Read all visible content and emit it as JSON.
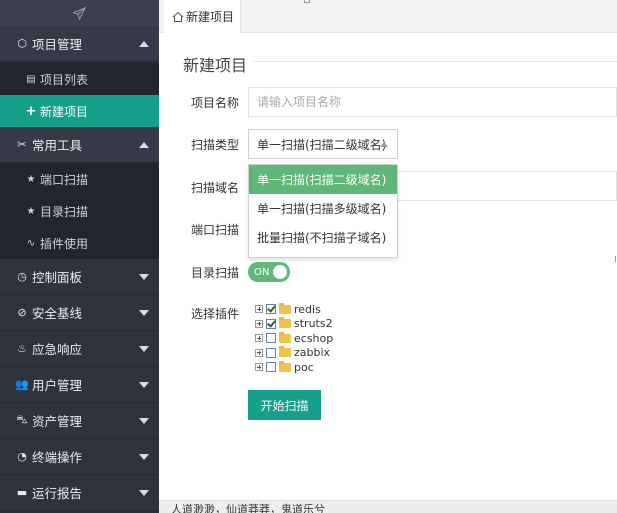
{
  "sidebar": {
    "groups": [
      {
        "label": "项目管理",
        "icon": "cube-icon",
        "expanded": true,
        "items": [
          {
            "label": "项目列表",
            "icon": "file-icon"
          },
          {
            "label": "新建项目",
            "icon": "plus-icon",
            "active": true
          }
        ]
      },
      {
        "label": "常用工具",
        "icon": "tools-icon",
        "expanded": true,
        "items": [
          {
            "label": "端口扫描",
            "icon": "star-icon"
          },
          {
            "label": "目录扫描",
            "icon": "star-icon"
          },
          {
            "label": "插件使用",
            "icon": "pulse-icon"
          }
        ]
      },
      {
        "label": "控制面板",
        "icon": "dashboard-icon",
        "expanded": false
      },
      {
        "label": "安全基线",
        "icon": "check-circle-icon",
        "expanded": false
      },
      {
        "label": "应急响应",
        "icon": "fire-icon",
        "expanded": false
      },
      {
        "label": "用户管理",
        "icon": "users-icon",
        "expanded": false
      },
      {
        "label": "资产管理",
        "icon": "cart-icon",
        "expanded": false
      },
      {
        "label": "终端操作",
        "icon": "gauge-icon",
        "expanded": false
      },
      {
        "label": "运行报告",
        "icon": "comment-icon",
        "expanded": false
      }
    ]
  },
  "tabs": [
    {
      "label": "新建项目",
      "icon": "home-icon",
      "active": true
    }
  ],
  "form": {
    "title": "新建项目",
    "project_name_label": "项目名称",
    "project_name_placeholder": "请输入项目名称",
    "scan_type_label": "扫描类型",
    "scan_type_value": "单一扫描(扫描二级域名)",
    "scan_type_options": [
      "单一扫描(扫描二级域名)",
      "单一扫描(扫描多级域名)",
      "批量扫描(不扫描子域名)"
    ],
    "scan_domain_label": "扫描域名",
    "port_scan_label": "端口扫描",
    "dir_scan_label": "目录扫描",
    "dir_scan_toggle": "ON",
    "plugins_label": "选择插件",
    "plugins": [
      {
        "name": "redis",
        "checked": true
      },
      {
        "name": "struts2",
        "checked": true
      },
      {
        "name": "ecshop",
        "checked": false
      },
      {
        "name": "zabbix",
        "checked": false
      },
      {
        "name": "poc",
        "checked": false
      }
    ],
    "start_button": "开始扫描"
  },
  "footer": {
    "text": "人道渺渺，仙道莽莽，鬼道乐兮"
  },
  "colors": {
    "sidebar_bg": "#2b2f3a",
    "active_green": "#15a08a",
    "option_green": "#5fb878"
  }
}
